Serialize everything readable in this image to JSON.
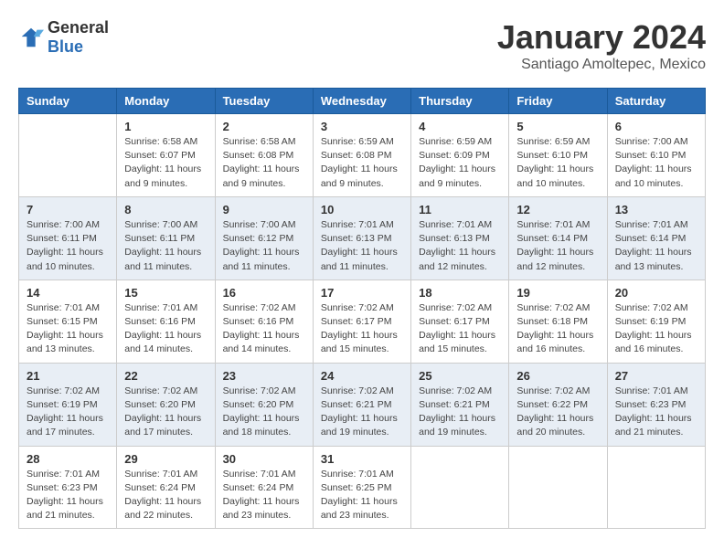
{
  "header": {
    "logo_general": "General",
    "logo_blue": "Blue",
    "month_year": "January 2024",
    "location": "Santiago Amoltepec, Mexico"
  },
  "weekdays": [
    "Sunday",
    "Monday",
    "Tuesday",
    "Wednesday",
    "Thursday",
    "Friday",
    "Saturday"
  ],
  "weeks": [
    [
      {
        "day": "",
        "sunrise": "",
        "sunset": "",
        "daylight": ""
      },
      {
        "day": "1",
        "sunrise": "Sunrise: 6:58 AM",
        "sunset": "Sunset: 6:07 PM",
        "daylight": "Daylight: 11 hours and 9 minutes."
      },
      {
        "day": "2",
        "sunrise": "Sunrise: 6:58 AM",
        "sunset": "Sunset: 6:08 PM",
        "daylight": "Daylight: 11 hours and 9 minutes."
      },
      {
        "day": "3",
        "sunrise": "Sunrise: 6:59 AM",
        "sunset": "Sunset: 6:08 PM",
        "daylight": "Daylight: 11 hours and 9 minutes."
      },
      {
        "day": "4",
        "sunrise": "Sunrise: 6:59 AM",
        "sunset": "Sunset: 6:09 PM",
        "daylight": "Daylight: 11 hours and 9 minutes."
      },
      {
        "day": "5",
        "sunrise": "Sunrise: 6:59 AM",
        "sunset": "Sunset: 6:10 PM",
        "daylight": "Daylight: 11 hours and 10 minutes."
      },
      {
        "day": "6",
        "sunrise": "Sunrise: 7:00 AM",
        "sunset": "Sunset: 6:10 PM",
        "daylight": "Daylight: 11 hours and 10 minutes."
      }
    ],
    [
      {
        "day": "7",
        "sunrise": "Sunrise: 7:00 AM",
        "sunset": "Sunset: 6:11 PM",
        "daylight": "Daylight: 11 hours and 10 minutes."
      },
      {
        "day": "8",
        "sunrise": "Sunrise: 7:00 AM",
        "sunset": "Sunset: 6:11 PM",
        "daylight": "Daylight: 11 hours and 11 minutes."
      },
      {
        "day": "9",
        "sunrise": "Sunrise: 7:00 AM",
        "sunset": "Sunset: 6:12 PM",
        "daylight": "Daylight: 11 hours and 11 minutes."
      },
      {
        "day": "10",
        "sunrise": "Sunrise: 7:01 AM",
        "sunset": "Sunset: 6:13 PM",
        "daylight": "Daylight: 11 hours and 11 minutes."
      },
      {
        "day": "11",
        "sunrise": "Sunrise: 7:01 AM",
        "sunset": "Sunset: 6:13 PM",
        "daylight": "Daylight: 11 hours and 12 minutes."
      },
      {
        "day": "12",
        "sunrise": "Sunrise: 7:01 AM",
        "sunset": "Sunset: 6:14 PM",
        "daylight": "Daylight: 11 hours and 12 minutes."
      },
      {
        "day": "13",
        "sunrise": "Sunrise: 7:01 AM",
        "sunset": "Sunset: 6:14 PM",
        "daylight": "Daylight: 11 hours and 13 minutes."
      }
    ],
    [
      {
        "day": "14",
        "sunrise": "Sunrise: 7:01 AM",
        "sunset": "Sunset: 6:15 PM",
        "daylight": "Daylight: 11 hours and 13 minutes."
      },
      {
        "day": "15",
        "sunrise": "Sunrise: 7:01 AM",
        "sunset": "Sunset: 6:16 PM",
        "daylight": "Daylight: 11 hours and 14 minutes."
      },
      {
        "day": "16",
        "sunrise": "Sunrise: 7:02 AM",
        "sunset": "Sunset: 6:16 PM",
        "daylight": "Daylight: 11 hours and 14 minutes."
      },
      {
        "day": "17",
        "sunrise": "Sunrise: 7:02 AM",
        "sunset": "Sunset: 6:17 PM",
        "daylight": "Daylight: 11 hours and 15 minutes."
      },
      {
        "day": "18",
        "sunrise": "Sunrise: 7:02 AM",
        "sunset": "Sunset: 6:17 PM",
        "daylight": "Daylight: 11 hours and 15 minutes."
      },
      {
        "day": "19",
        "sunrise": "Sunrise: 7:02 AM",
        "sunset": "Sunset: 6:18 PM",
        "daylight": "Daylight: 11 hours and 16 minutes."
      },
      {
        "day": "20",
        "sunrise": "Sunrise: 7:02 AM",
        "sunset": "Sunset: 6:19 PM",
        "daylight": "Daylight: 11 hours and 16 minutes."
      }
    ],
    [
      {
        "day": "21",
        "sunrise": "Sunrise: 7:02 AM",
        "sunset": "Sunset: 6:19 PM",
        "daylight": "Daylight: 11 hours and 17 minutes."
      },
      {
        "day": "22",
        "sunrise": "Sunrise: 7:02 AM",
        "sunset": "Sunset: 6:20 PM",
        "daylight": "Daylight: 11 hours and 17 minutes."
      },
      {
        "day": "23",
        "sunrise": "Sunrise: 7:02 AM",
        "sunset": "Sunset: 6:20 PM",
        "daylight": "Daylight: 11 hours and 18 minutes."
      },
      {
        "day": "24",
        "sunrise": "Sunrise: 7:02 AM",
        "sunset": "Sunset: 6:21 PM",
        "daylight": "Daylight: 11 hours and 19 minutes."
      },
      {
        "day": "25",
        "sunrise": "Sunrise: 7:02 AM",
        "sunset": "Sunset: 6:21 PM",
        "daylight": "Daylight: 11 hours and 19 minutes."
      },
      {
        "day": "26",
        "sunrise": "Sunrise: 7:02 AM",
        "sunset": "Sunset: 6:22 PM",
        "daylight": "Daylight: 11 hours and 20 minutes."
      },
      {
        "day": "27",
        "sunrise": "Sunrise: 7:01 AM",
        "sunset": "Sunset: 6:23 PM",
        "daylight": "Daylight: 11 hours and 21 minutes."
      }
    ],
    [
      {
        "day": "28",
        "sunrise": "Sunrise: 7:01 AM",
        "sunset": "Sunset: 6:23 PM",
        "daylight": "Daylight: 11 hours and 21 minutes."
      },
      {
        "day": "29",
        "sunrise": "Sunrise: 7:01 AM",
        "sunset": "Sunset: 6:24 PM",
        "daylight": "Daylight: 11 hours and 22 minutes."
      },
      {
        "day": "30",
        "sunrise": "Sunrise: 7:01 AM",
        "sunset": "Sunset: 6:24 PM",
        "daylight": "Daylight: 11 hours and 23 minutes."
      },
      {
        "day": "31",
        "sunrise": "Sunrise: 7:01 AM",
        "sunset": "Sunset: 6:25 PM",
        "daylight": "Daylight: 11 hours and 23 minutes."
      },
      {
        "day": "",
        "sunrise": "",
        "sunset": "",
        "daylight": ""
      },
      {
        "day": "",
        "sunrise": "",
        "sunset": "",
        "daylight": ""
      },
      {
        "day": "",
        "sunrise": "",
        "sunset": "",
        "daylight": ""
      }
    ]
  ]
}
